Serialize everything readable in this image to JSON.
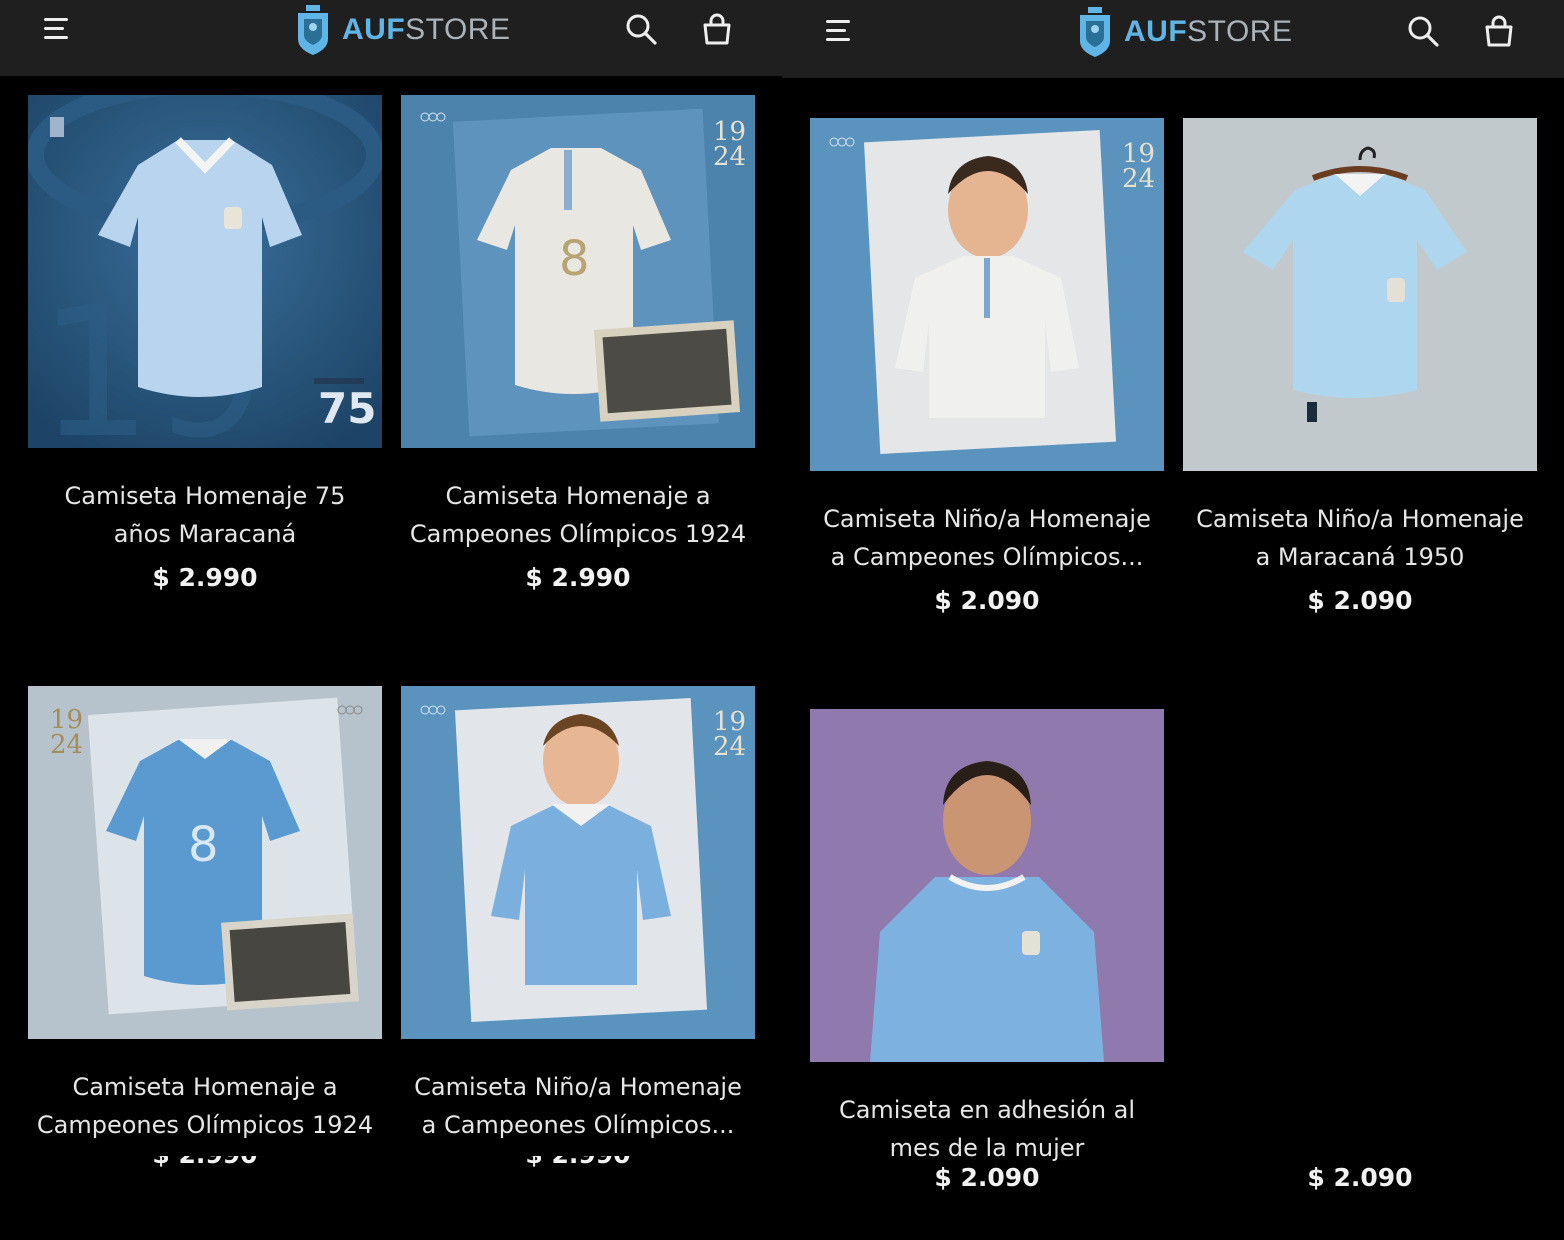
{
  "brand": {
    "logo_bold": "AUF",
    "logo_light": "STORE",
    "accent": "#5fb6e6"
  },
  "left_panel": {
    "products": [
      {
        "title_line1": "Camiseta Homenaje 75",
        "title_line2": "años Maracaná",
        "price": "$ 2.990"
      },
      {
        "title_line1": "Camiseta Homenaje a",
        "title_line2": "Campeones Olímpicos 1924",
        "price": "$ 2.990"
      },
      {
        "title_line1": "Camiseta Homenaje a",
        "title_line2": "Campeones Olímpicos 1924",
        "price": "$ 2.990"
      },
      {
        "title_line1": "Camiseta Niño/a Homenaje",
        "title_line2": "a Campeones Olímpicos...",
        "price": "$ 2.990"
      }
    ]
  },
  "right_panel": {
    "products": [
      {
        "title_line1": "Camiseta Niño/a Homenaje",
        "title_line2": "a Campeones Olímpicos...",
        "price": "$ 2.090"
      },
      {
        "title_line1": "Camiseta Niño/a Homenaje",
        "title_line2": "a Maracaná 1950",
        "price": "$ 2.090"
      },
      {
        "title_line1": "Camiseta en adhesión al",
        "title_line2": "mes de la mujer",
        "price": "$ 2.090"
      },
      {
        "title_line1": "",
        "title_line2": "",
        "price": "$ 2.090"
      }
    ]
  },
  "image_text": {
    "badge_75": "75",
    "year_19": "19",
    "year_24": "24"
  }
}
